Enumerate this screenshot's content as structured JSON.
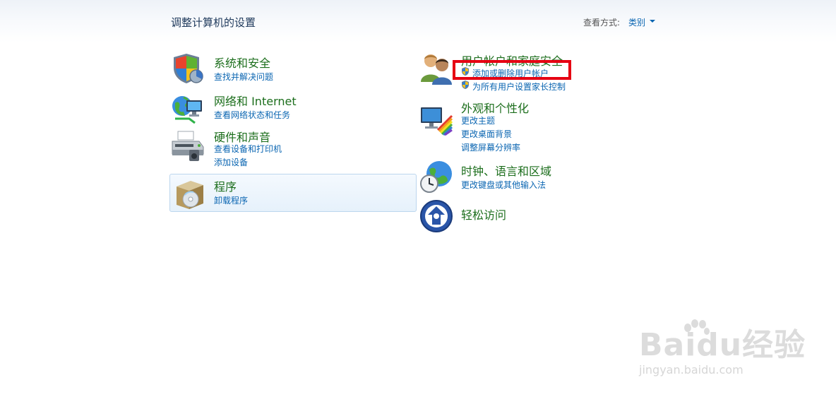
{
  "page": {
    "title": "调整计算机的设置",
    "view_by_label": "查看方式:",
    "view_by_value": "类别"
  },
  "categories": {
    "security": {
      "title": "系统和安全",
      "icon": "shield-icon",
      "links": [
        "查找并解决问题"
      ]
    },
    "network": {
      "title": "网络和 Internet",
      "icon": "globe-network-icon",
      "links": [
        "查看网络状态和任务"
      ]
    },
    "hardware": {
      "title": "硬件和声音",
      "icon": "printer-icon",
      "links": [
        "查看设备和打印机",
        "添加设备"
      ]
    },
    "programs": {
      "title": "程序",
      "icon": "programs-icon",
      "links": [
        "卸载程序"
      ]
    },
    "users": {
      "title": "用户帐户和家庭安全",
      "icon": "users-icon",
      "links": [
        "添加或删除用户帐户",
        "为所有用户设置家长控制"
      ]
    },
    "appearance": {
      "title": "外观和个性化",
      "icon": "monitor-palette-icon",
      "links": [
        "更改主题",
        "更改桌面背景",
        "调整屏幕分辨率"
      ]
    },
    "clock": {
      "title": "时钟、语言和区域",
      "icon": "clock-globe-icon",
      "links": [
        "更改键盘或其他输入法"
      ]
    },
    "access": {
      "title": "轻松访问",
      "icon": "ease-of-access-icon",
      "links": []
    }
  },
  "highlight_color": "#e60012",
  "watermark": {
    "logo": "Baidu经验",
    "url": "jingyan.baidu.com"
  }
}
